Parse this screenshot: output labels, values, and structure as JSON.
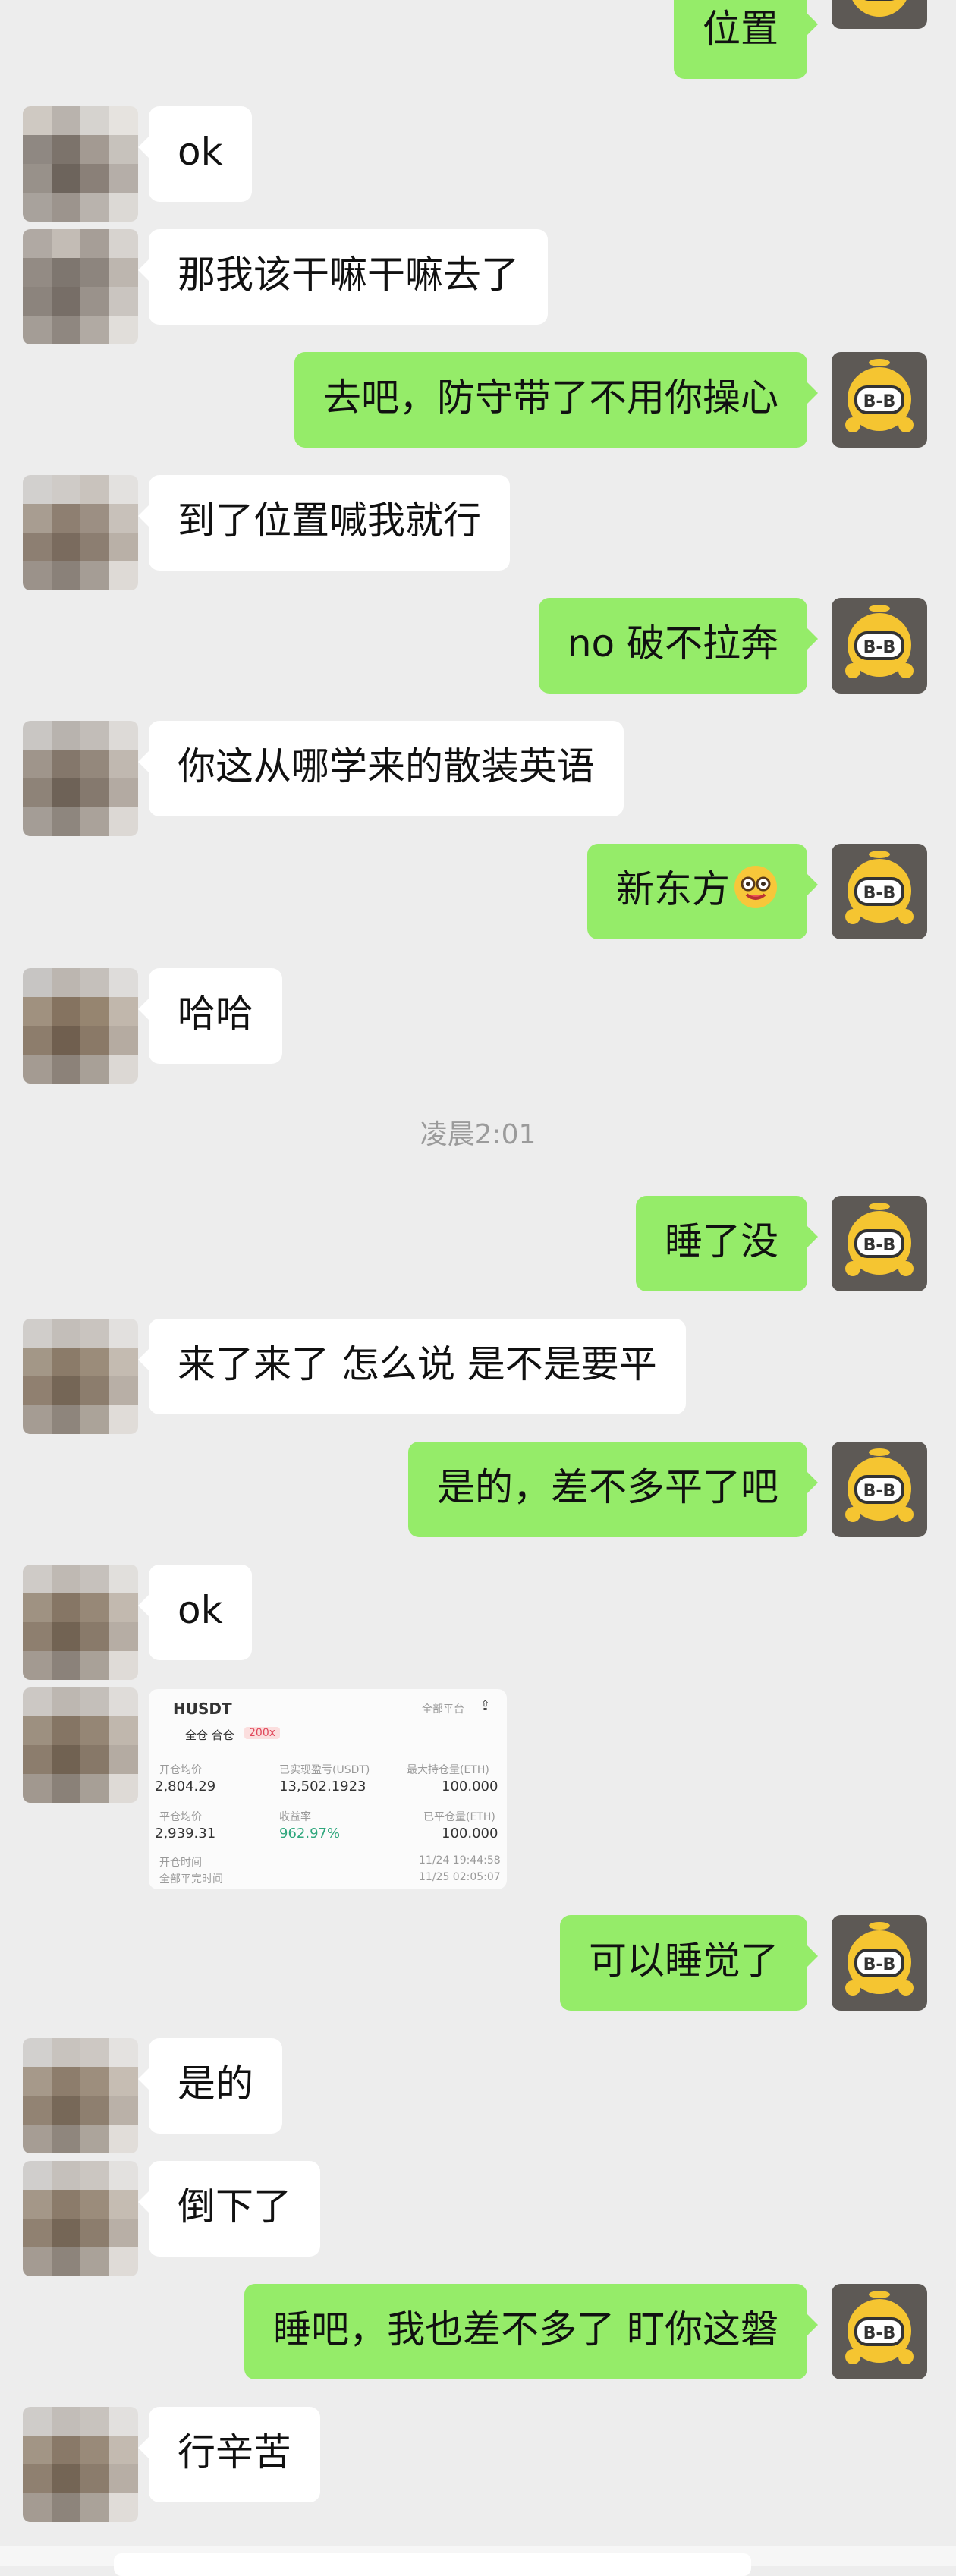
{
  "messages": [
    {
      "side": "out",
      "text": "位置",
      "timestamp_line": ""
    },
    {
      "side": "in",
      "text": "ok"
    },
    {
      "side": "in",
      "text": "那我该干嘛干嘛去了"
    },
    {
      "side": "out",
      "text": "去吧，防守带了不用你操心"
    },
    {
      "side": "in",
      "text": "到了位置喊我就行"
    },
    {
      "side": "out",
      "text": "no 破不拉奔"
    },
    {
      "side": "in",
      "text": "你这从哪学来的散装英语"
    },
    {
      "side": "out",
      "text": "新东方"
    },
    {
      "side": "in",
      "text": "哈哈"
    },
    {
      "side": "out",
      "text": "睡了没"
    },
    {
      "side": "in",
      "text": "来了来了 怎么说 是不是要平"
    },
    {
      "side": "out",
      "text": "是的，差不多平了吧"
    },
    {
      "side": "in",
      "text": "ok"
    },
    {
      "side": "out",
      "text": "可以睡觉了"
    },
    {
      "side": "in",
      "text": "是的"
    },
    {
      "side": "in",
      "text": "倒下了"
    },
    {
      "side": "out",
      "text": "睡吧，我也差不多了 盯你这磐"
    },
    {
      "side": "in",
      "text": "行辛苦"
    }
  ],
  "time_divider": "凌晨2:01",
  "emoji": "nerd-face-emoji",
  "card": {
    "pair": "HUSDT",
    "platform": "全部平台",
    "mode": "全仓 合仓",
    "leverage": "200x",
    "open_avg_label": "开仓均价",
    "open_avg": "2,804.29",
    "realized_label": "已实现盈亏(USDT)",
    "realized": "13,502.1923",
    "max_hold_label": "最大持仓量(ETH)",
    "max_hold": "100.000",
    "close_avg_label": "平仓均价",
    "close_avg": "2,939.31",
    "roi_label": "收益率",
    "roi": "962.97%",
    "closed_qty_label": "已平仓量(ETH)",
    "closed_qty": "100.000",
    "open_time_label": "开仓时间",
    "open_time": "11/24 19:44:58",
    "close_time_label": "全部平完时间",
    "close_time": "11/25 02:05:07"
  },
  "colors": {
    "background": "#ededed",
    "incoming": "#ffffff",
    "outgoing": "#95ec69",
    "time": "#9b9b9b"
  }
}
